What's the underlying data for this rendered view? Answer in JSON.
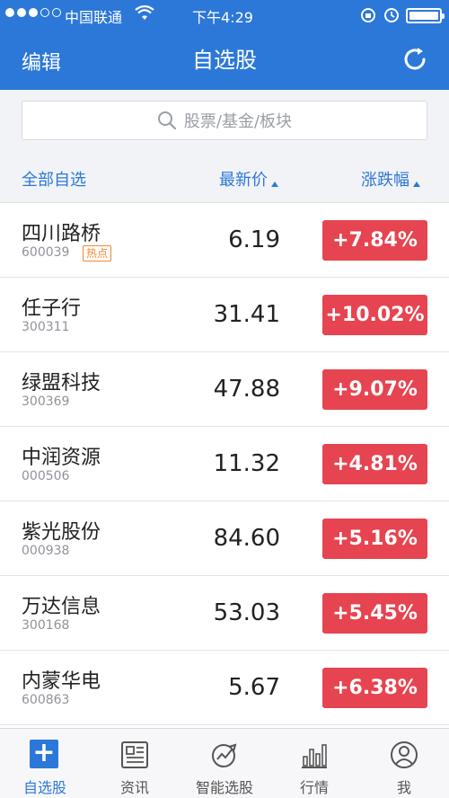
{
  "statusbar": {
    "carrier": "中国联通",
    "time": "下午4:29"
  },
  "navbar": {
    "edit_label": "编辑",
    "title": "自选股"
  },
  "search": {
    "placeholder": "股票/基金/板块"
  },
  "header": {
    "all_label": "全部自选",
    "price_label": "最新价",
    "change_label": "涨跌幅"
  },
  "stocks": [
    {
      "name": "四川路桥",
      "code": "600039",
      "tag": "热点",
      "price": "6.19",
      "change": "+7.84%"
    },
    {
      "name": "任子行",
      "code": "300311",
      "price": "31.41",
      "change": "+10.02%"
    },
    {
      "name": "绿盟科技",
      "code": "300369",
      "price": "47.88",
      "change": "+9.07%"
    },
    {
      "name": "中润资源",
      "code": "000506",
      "price": "11.32",
      "change": "+4.81%"
    },
    {
      "name": "紫光股份",
      "code": "000938",
      "price": "84.60",
      "change": "+5.16%"
    },
    {
      "name": "万达信息",
      "code": "300168",
      "price": "53.03",
      "change": "+5.45%"
    },
    {
      "name": "内蒙华电",
      "code": "600863",
      "price": "5.67",
      "change": "+6.38%"
    }
  ],
  "tabs": [
    {
      "label": "自选股",
      "icon": "plus-icon"
    },
    {
      "label": "资讯",
      "icon": "news-icon"
    },
    {
      "label": "智能选股",
      "icon": "smart-pick-icon"
    },
    {
      "label": "行情",
      "icon": "market-chart-icon"
    },
    {
      "label": "我",
      "icon": "user-icon"
    }
  ],
  "colors": {
    "primary": "#2c78d8",
    "up_red": "#e64450",
    "hot_orange": "#f0882e"
  }
}
